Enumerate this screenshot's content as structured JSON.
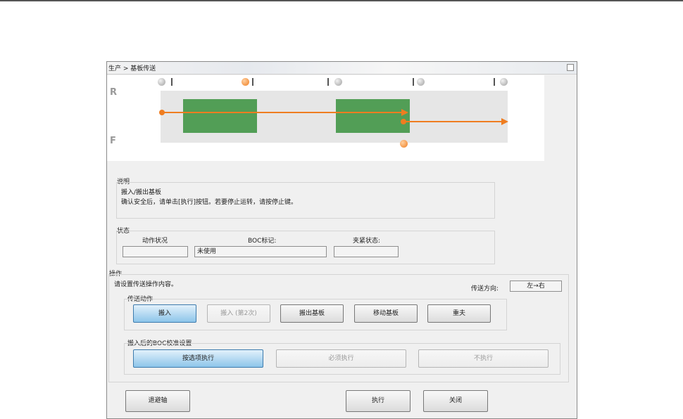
{
  "window": {
    "title": "生产 > 基板传送"
  },
  "diagram": {
    "rail_r_label": "R",
    "rail_f_label": "F"
  },
  "description": {
    "title": "说明",
    "line1": "搬入/搬出基板",
    "line2": "确认安全后，请单击[执行]按钮。若要停止运转，请按停止键。"
  },
  "status": {
    "title": "状态",
    "action_label": "动作状况",
    "action_value": "",
    "boc_label": "BOC标记:",
    "boc_value": "未使用",
    "clamp_label": "夹紧状态:",
    "clamp_value": ""
  },
  "operation": {
    "title": "操作",
    "hint": "请设置传送操作内容。",
    "direction_label": "传送方向:",
    "direction_value": "左→右",
    "transfer": {
      "title": "传送动作",
      "buttons": [
        "搬入",
        "搬入 (第2次)",
        "搬出基板",
        "移动基板",
        "重夫"
      ]
    },
    "boc": {
      "title": "搬入后的BOC校准设置",
      "buttons": [
        "按选项执行",
        "必须执行",
        "不执行"
      ]
    }
  },
  "footer": {
    "retract": "退避轴",
    "execute": "执行",
    "close": "关闭"
  }
}
